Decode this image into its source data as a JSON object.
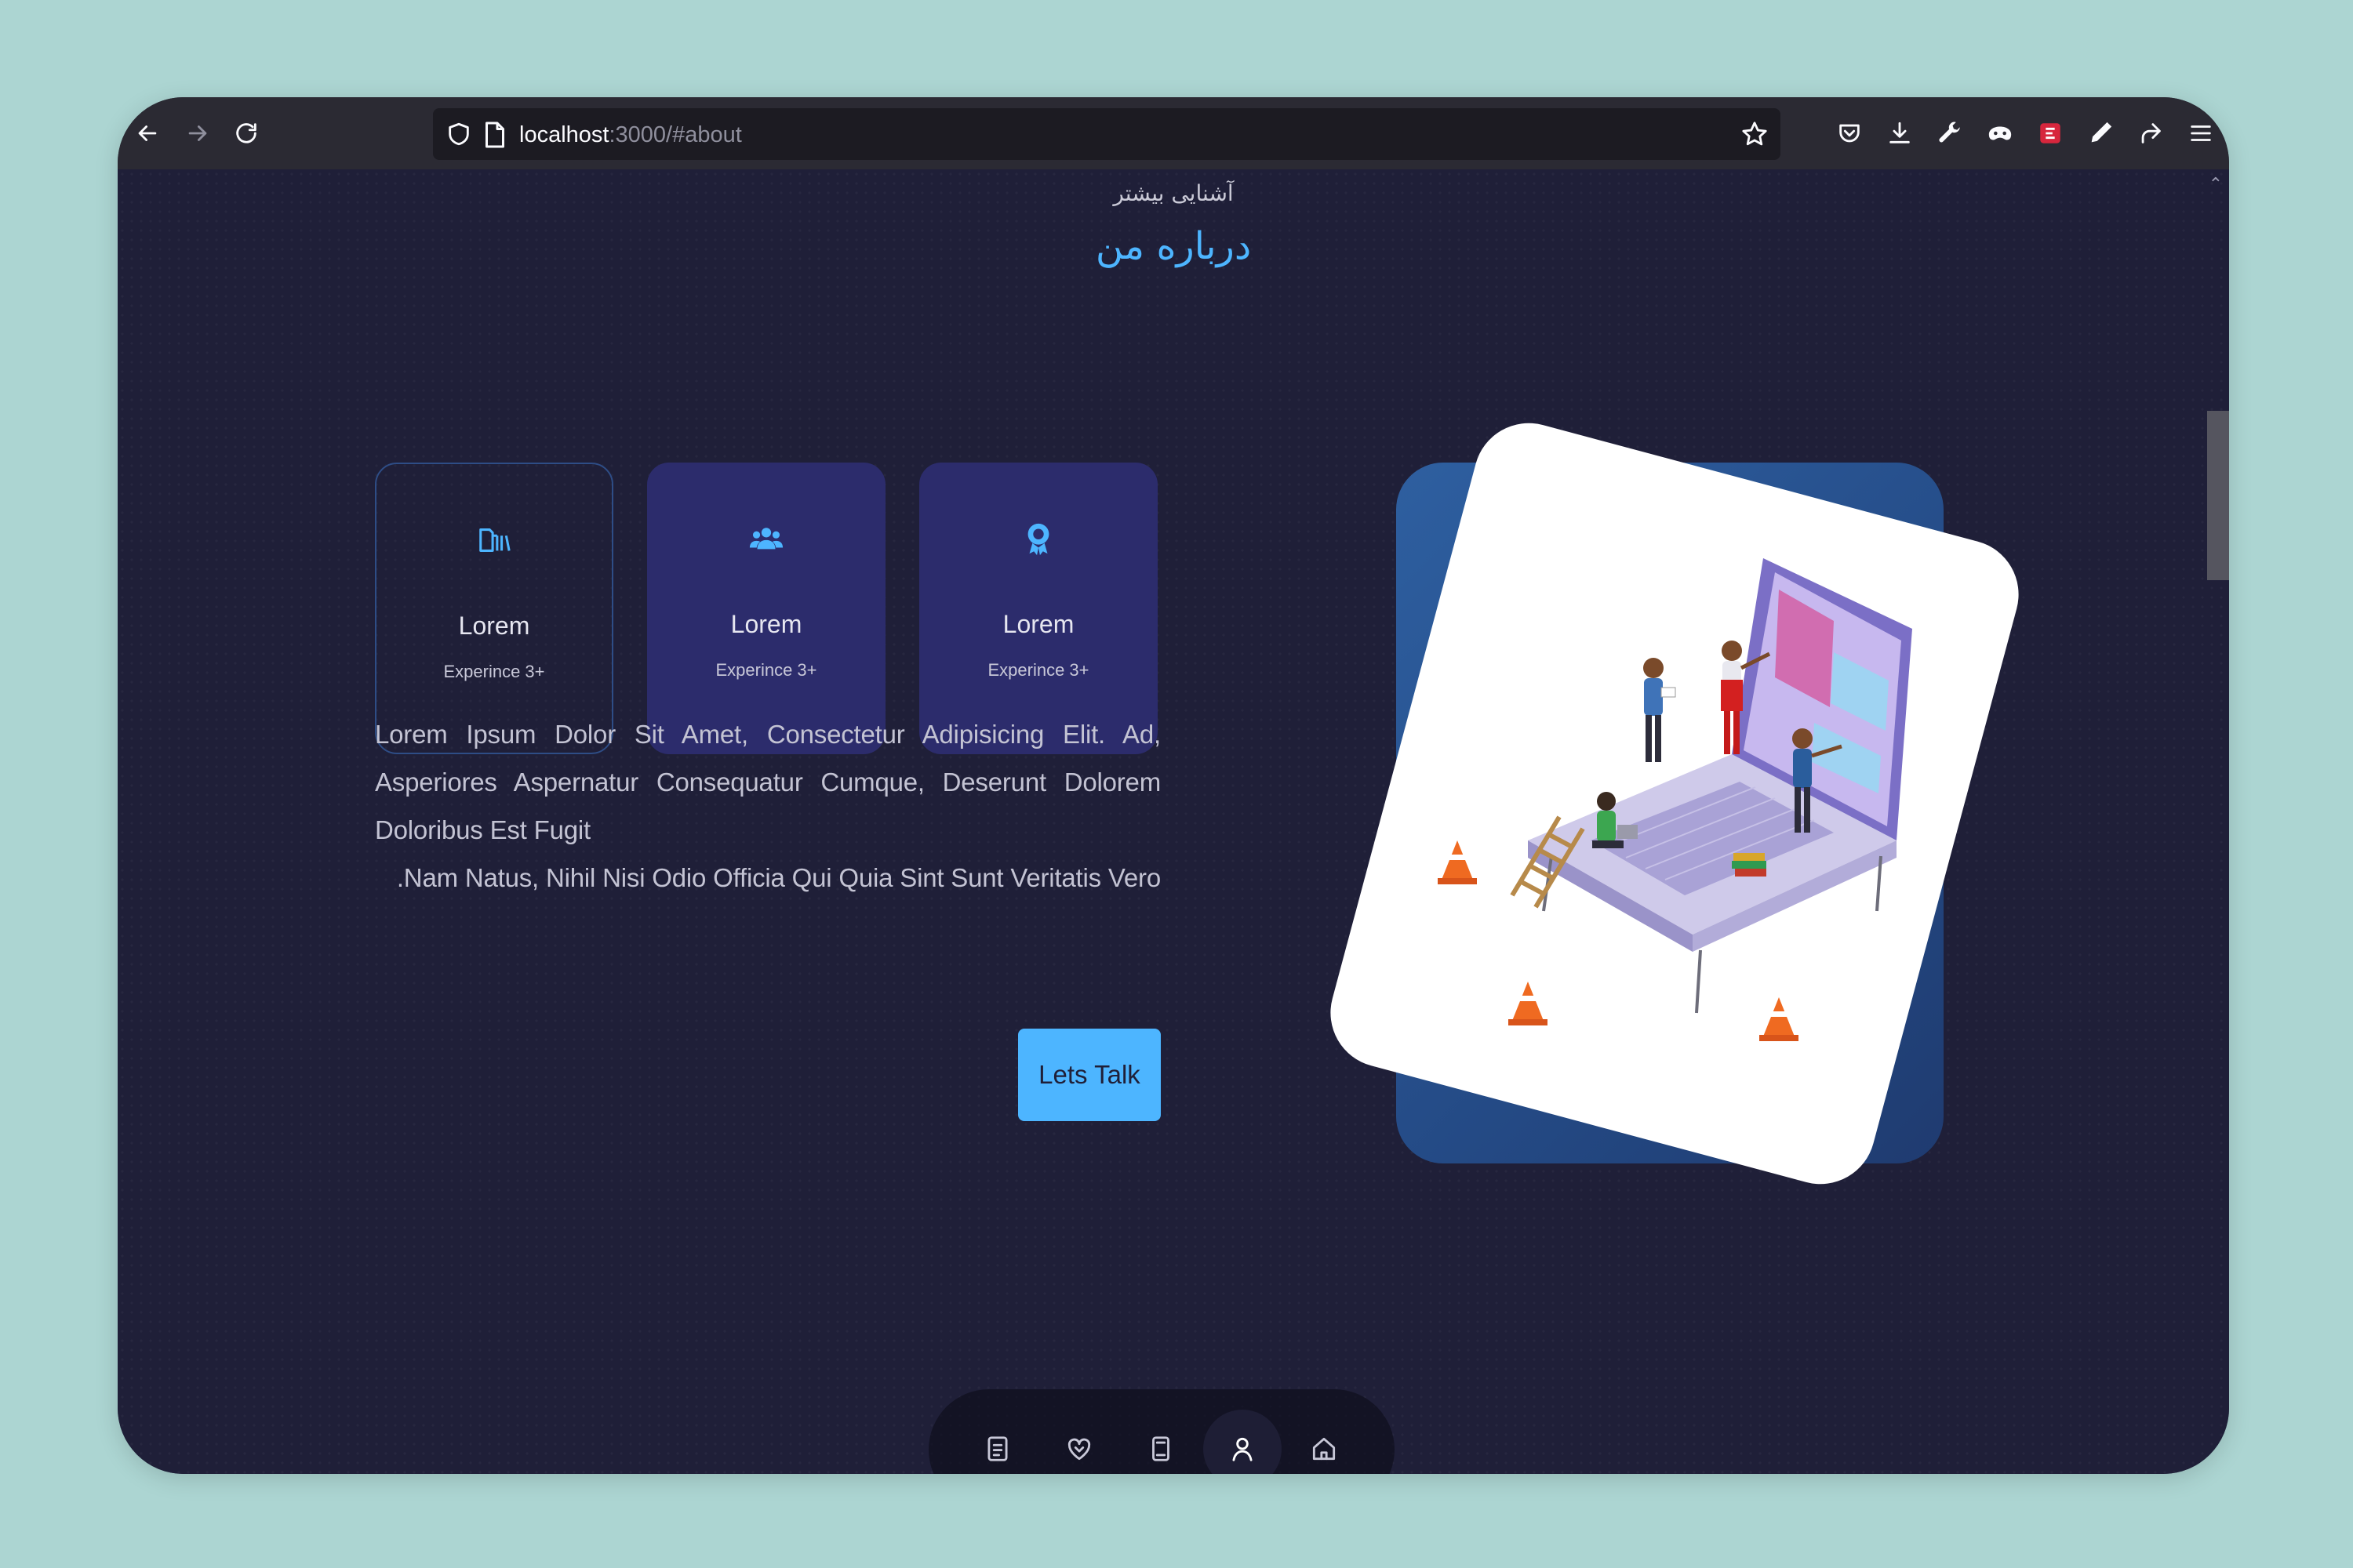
{
  "browser": {
    "url_host": "localhost",
    "url_path": ":3000/#about"
  },
  "section": {
    "subtitle": "آشنایی بیشتر",
    "title": "درباره من"
  },
  "cards": [
    {
      "title": "Lorem",
      "sub": "Experince 3+",
      "icon": "library-icon"
    },
    {
      "title": "Lorem",
      "sub": "Experince 3+",
      "icon": "users-icon"
    },
    {
      "title": "Lorem",
      "sub": "Experince 3+",
      "icon": "award-icon"
    }
  ],
  "about": {
    "paragraph_main": "Lorem Ipsum Dolor Sit Amet, Consectetur Adipisicing Elit. Ad, Asperiores Aspernatur Consequatur Cumque, Deserunt Dolorem Doloribus Est Fugit",
    "paragraph_last": ".Nam Natus, Nihil Nisi Odio Officia Qui Quia Sint Sunt Veritatis Vero",
    "button": "Lets Talk"
  },
  "colors": {
    "accent": "#4db5ff",
    "background": "#1f1f38",
    "card": "#2c2c6c",
    "page_bg": "#acd5d2"
  },
  "bottom_nav": [
    "file-text-icon",
    "heart-handshake-icon",
    "book-icon",
    "user-icon",
    "home-icon"
  ],
  "bottom_nav_active": "user-icon"
}
